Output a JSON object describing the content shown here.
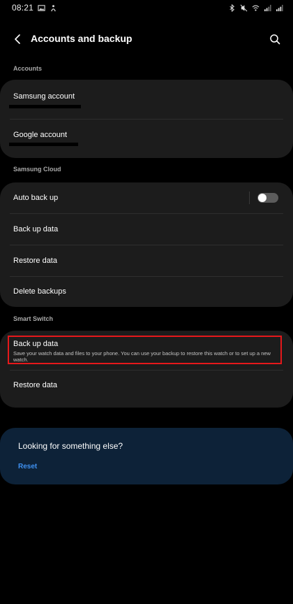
{
  "status_bar": {
    "time": "08:21",
    "left_icons": [
      "gallery-icon",
      "notification-icon"
    ],
    "right_icons": [
      "bluetooth-icon",
      "mute-icon",
      "wifi-icon",
      "signal-icon",
      "signal-icon-2"
    ]
  },
  "header": {
    "title": "Accounts and backup",
    "back_icon": "back-arrow-icon",
    "search_icon": "search-icon"
  },
  "sections": {
    "accounts": {
      "header": "Accounts",
      "items": [
        {
          "label": "Samsung account"
        },
        {
          "label": "Google account"
        }
      ]
    },
    "samsung_cloud": {
      "header": "Samsung Cloud",
      "items": [
        {
          "label": "Auto back up",
          "toggle": "off"
        },
        {
          "label": "Back up data"
        },
        {
          "label": "Restore data"
        },
        {
          "label": "Delete backups"
        }
      ]
    },
    "smart_switch": {
      "header": "Smart Switch",
      "items": [
        {
          "label": "Back up data",
          "description": "Save your watch data and files to your phone. You can use your backup to restore this watch or to set up a new watch.",
          "highlighted": true
        },
        {
          "label": "Restore data"
        }
      ]
    }
  },
  "suggestion": {
    "title": "Looking for something else?",
    "link": "Reset"
  },
  "colors": {
    "background": "#000000",
    "card": "#1c1c1c",
    "suggestion_card": "#0d2238",
    "link": "#3e90f0",
    "highlight": "#e6181b"
  }
}
